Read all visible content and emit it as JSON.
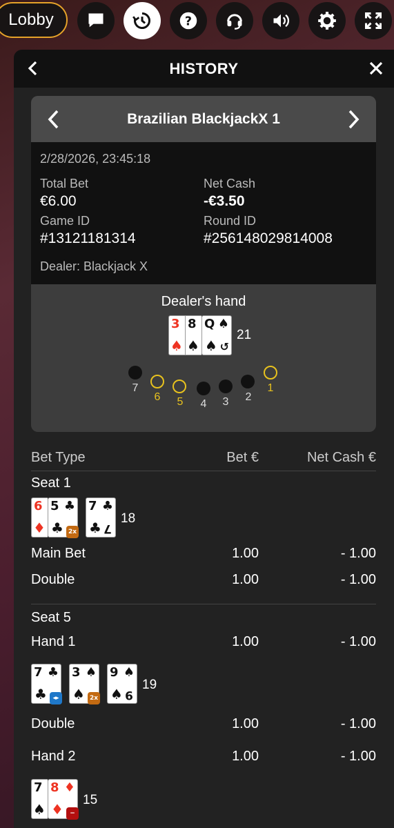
{
  "topbar": {
    "lobby_label": "Lobby",
    "icons": [
      "chat-icon",
      "history-icon",
      "help-icon",
      "support-icon",
      "sound-icon",
      "settings-icon",
      "fullscreen-icon"
    ]
  },
  "panel": {
    "title": "HISTORY"
  },
  "round": {
    "game_name": "Brazilian BlackjackX 1",
    "datetime": "2/28/2026, 23:45:18",
    "total_bet_label": "Total Bet",
    "total_bet_value": "€6.00",
    "net_cash_label": "Net Cash",
    "net_cash_value": "-€3.50",
    "game_id_label": "Game ID",
    "game_id_value": "#13121181314",
    "round_id_label": "Round ID",
    "round_id_value": "#256148029814008",
    "dealer_line": "Dealer: Blackjack X"
  },
  "dealer": {
    "title": "Dealer's hand",
    "cards": [
      {
        "rank": "3",
        "suit": "♠",
        "color": "red"
      },
      {
        "rank": "8",
        "suit": "♠",
        "color": "black"
      },
      {
        "rank": "Q",
        "suit": "♠",
        "color": "black"
      }
    ],
    "score": "21",
    "seats": [
      {
        "num": "7",
        "active": false
      },
      {
        "num": "6",
        "active": true
      },
      {
        "num": "5",
        "active": true
      },
      {
        "num": "4",
        "active": false
      },
      {
        "num": "3",
        "active": false
      },
      {
        "num": "2",
        "active": false
      },
      {
        "num": "1",
        "active": true
      }
    ]
  },
  "bets": {
    "header_type": "Bet Type",
    "header_bet": "Bet €",
    "header_net": "Net Cash €",
    "seat1": {
      "title": "Seat 1",
      "score": "18",
      "rows": [
        {
          "type": "Main Bet",
          "bet": "1.00",
          "net": "- 1.00"
        },
        {
          "type": "Double",
          "bet": "1.00",
          "net": "- 1.00"
        }
      ]
    },
    "seat5": {
      "title": "Seat 5",
      "hand1": {
        "type": "Hand 1",
        "bet": "1.00",
        "net": "- 1.00",
        "score": "19"
      },
      "hand1_double": {
        "type": "Double",
        "bet": "1.00",
        "net": "- 1.00"
      },
      "hand2": {
        "type": "Hand 2",
        "bet": "1.00",
        "net": "- 1.00",
        "score": "15"
      }
    }
  }
}
